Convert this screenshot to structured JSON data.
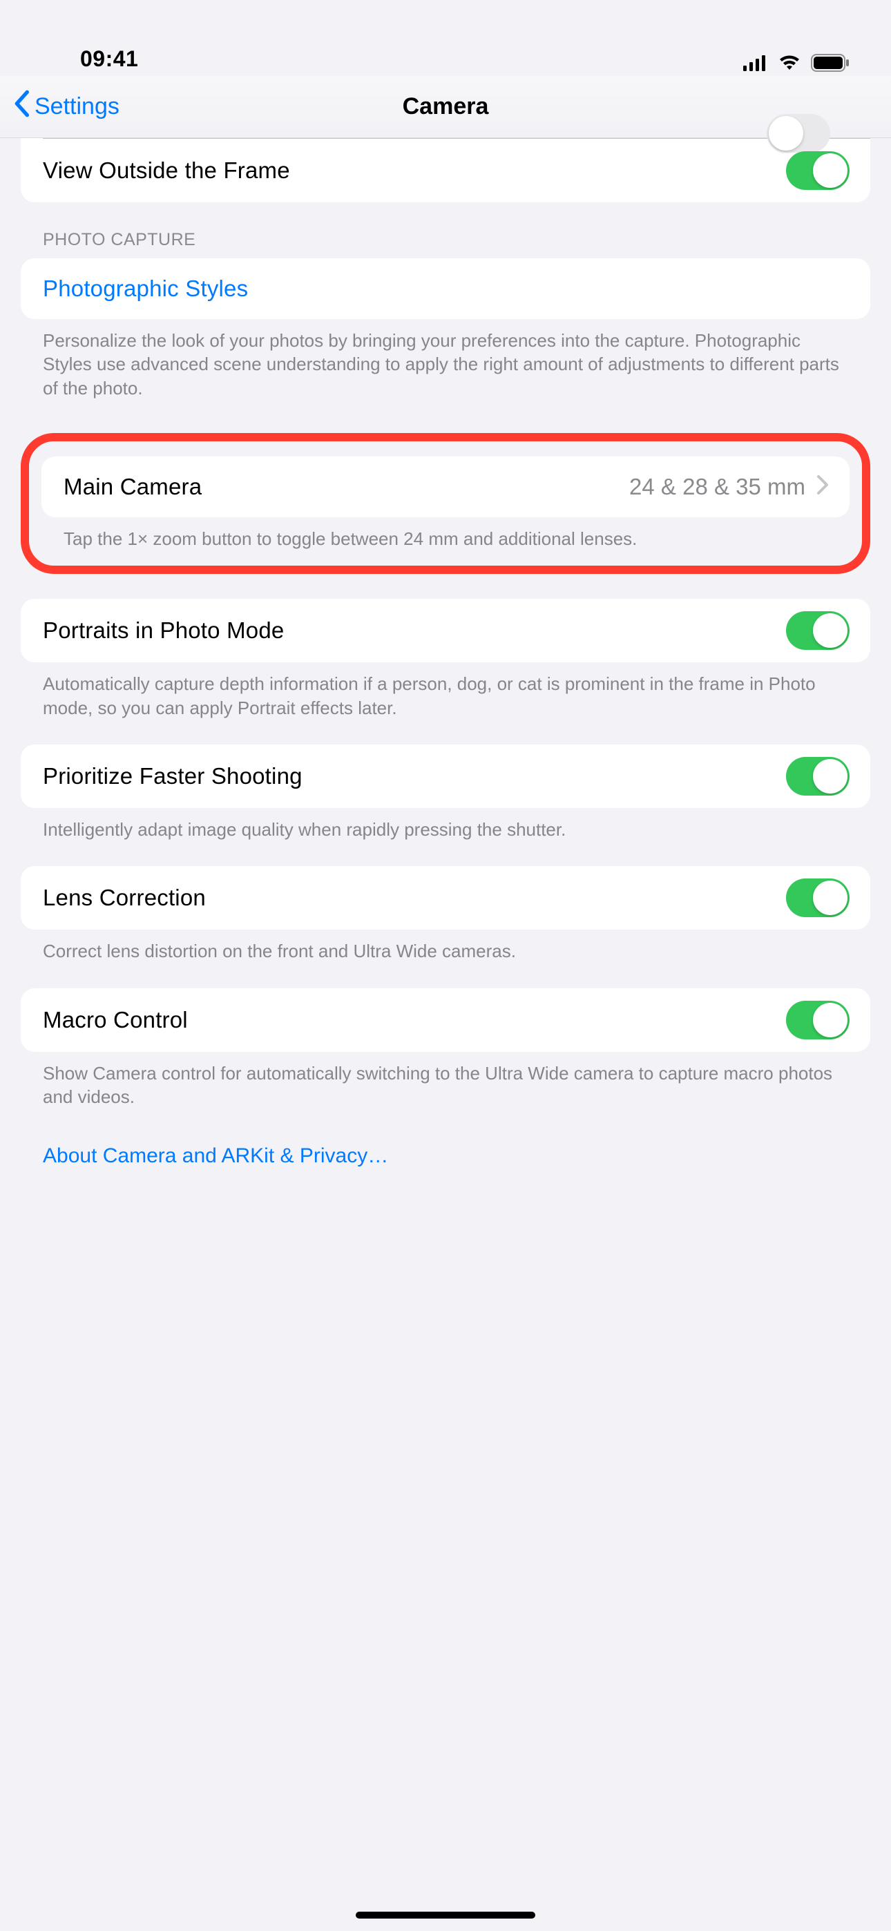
{
  "status": {
    "time": "09:41"
  },
  "nav": {
    "back": "Settings",
    "title": "Camera"
  },
  "top_group": {
    "view_outside_frame": {
      "label": "View Outside the Frame",
      "on": true
    }
  },
  "photo_capture": {
    "header": "Photo Capture",
    "photographic_styles": {
      "label": "Photographic Styles"
    },
    "footer": "Personalize the look of your photos by bringing your preferences into the capture. Photographic Styles use advanced scene understanding to apply the right amount of adjustments to different parts of the photo."
  },
  "main_camera": {
    "label": "Main Camera",
    "value": "24 & 28 & 35 mm",
    "footer": "Tap the 1× zoom button to toggle between 24 mm and additional lenses."
  },
  "portraits": {
    "label": "Portraits in Photo Mode",
    "on": true,
    "footer": "Automatically capture depth information if a person, dog, or cat is prominent in the frame in Photo mode, so you can apply Portrait effects later."
  },
  "faster_shooting": {
    "label": "Prioritize Faster Shooting",
    "on": true,
    "footer": "Intelligently adapt image quality when rapidly pressing the shutter."
  },
  "lens_correction": {
    "label": "Lens Correction",
    "on": true,
    "footer": "Correct lens distortion on the front and Ultra Wide cameras."
  },
  "macro": {
    "label": "Macro Control",
    "on": true,
    "footer": "Show Camera control for automatically switching to the Ultra Wide camera to capture macro photos and videos."
  },
  "privacy_link": "About Camera and ARKit & Privacy…"
}
